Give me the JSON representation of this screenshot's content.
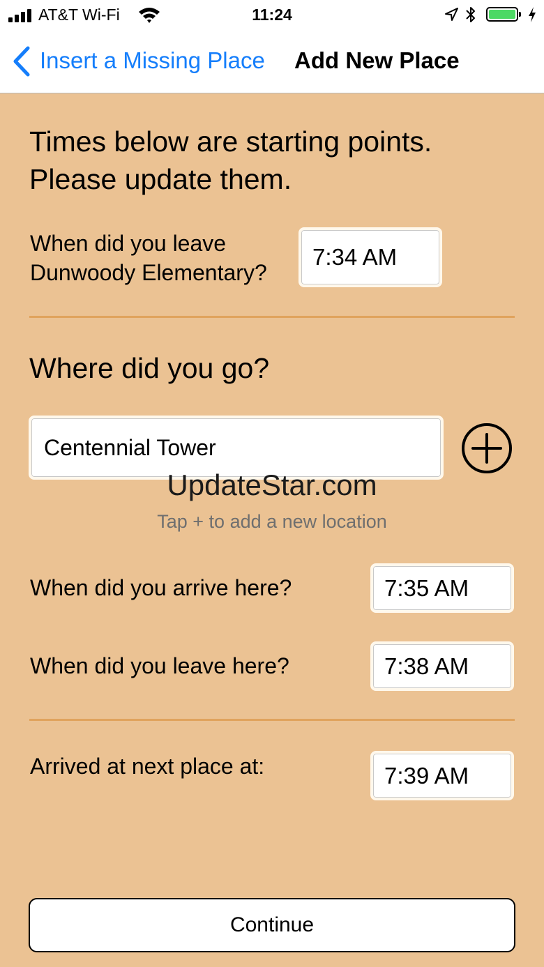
{
  "status_bar": {
    "carrier": "AT&T Wi-Fi",
    "time": "11:24",
    "signal_icon": "cellular-signal-icon",
    "wifi_icon": "wifi-icon",
    "location_icon": "location-arrow-icon",
    "bluetooth_icon": "bluetooth-icon",
    "battery_icon": "battery-icon",
    "battery_level": 1.0,
    "charging_icon": "charging-bolt-icon"
  },
  "nav": {
    "back_label": "Insert a Missing Place",
    "title": "Add New Place",
    "back_icon": "chevron-left-icon",
    "accent_color": "#157efb"
  },
  "intro": {
    "line1": "Times below are starting points.",
    "line2": "Please update them."
  },
  "leave_previous": {
    "label_line1": "When did you leave",
    "label_line2": "Dunwoody Elementary?",
    "time": "7:34 AM"
  },
  "where": {
    "title": "Where did you go?",
    "place_value": "Centennial Tower",
    "add_icon": "plus-circle-icon",
    "watermark": "UpdateStar.com",
    "hint": "Tap + to add a new location"
  },
  "arrive_here": {
    "label": "When did you arrive here?",
    "time": "7:35 AM"
  },
  "leave_here": {
    "label": "When did you leave here?",
    "time": "7:38 AM"
  },
  "arrive_next": {
    "label": "Arrived at next place at:",
    "time": "7:39 AM"
  },
  "continue_label": "Continue",
  "colors": {
    "background": "#ebc293",
    "divider": "#e0a35d",
    "battery": "#4cd964"
  }
}
